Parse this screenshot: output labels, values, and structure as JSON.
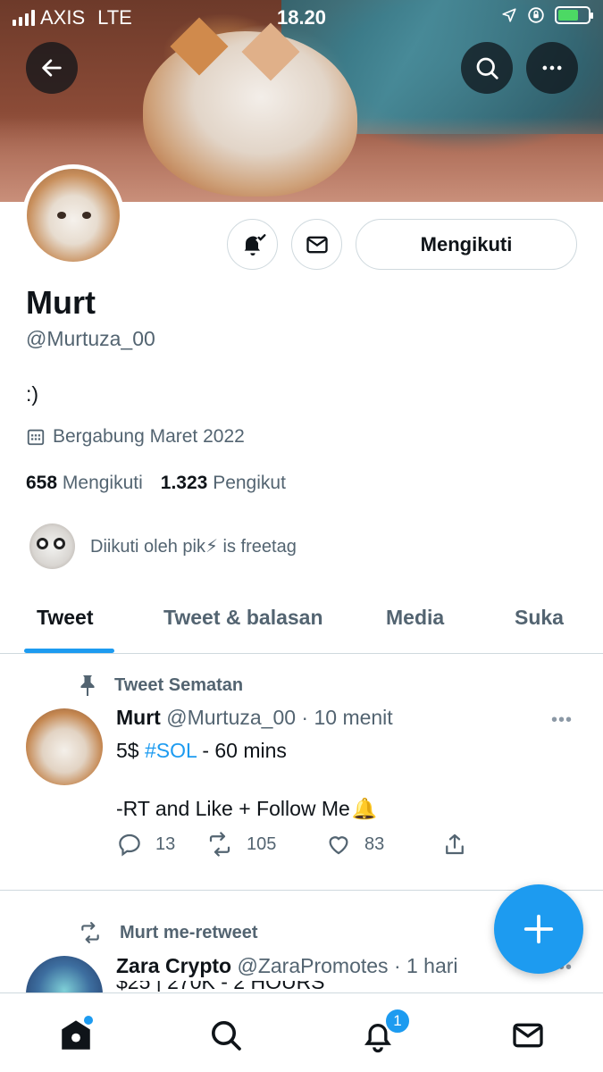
{
  "status_bar": {
    "carrier": "AXIS",
    "network": "LTE",
    "time": "18.20"
  },
  "header": {
    "back_icon": "arrow-left-icon",
    "search_icon": "search-icon",
    "more_icon": "more-horizontal-icon"
  },
  "profile": {
    "name": "Murt",
    "handle": "@Murtuza_00",
    "bio": ":)",
    "joined": "Bergabung Maret 2022",
    "following_count": "658",
    "following_label": "Mengikuti",
    "followers_count": "1.323",
    "followers_label": "Pengikut",
    "followed_by": "Diikuti oleh pik⚡ is freetag",
    "follow_button": "Mengikuti"
  },
  "tabs": [
    {
      "label": "Tweet",
      "active": true
    },
    {
      "label": "Tweet & balasan",
      "active": false
    },
    {
      "label": "Media",
      "active": false
    },
    {
      "label": "Suka",
      "active": false
    }
  ],
  "tweets": [
    {
      "context": "Tweet Sematan",
      "author": "Murt",
      "handle": "@Murtuza_00",
      "time": "· 10 menit",
      "text_prefix": "5$ ",
      "hashtag": "#SOL",
      "text_suffix": " - 60 mins",
      "text_line2": "-RT and Like + Follow Me",
      "emoji": "🔔",
      "replies": "13",
      "retweets": "105",
      "likes": "83",
      "more": "•••"
    },
    {
      "context": "Murt me-retweet",
      "author": "Zara Crypto",
      "handle": "@ZaraPromotes",
      "time": "· 1 hari",
      "text_preview": "$25 | 270K - 2 HOURS",
      "more": "•••"
    }
  ],
  "bottom_nav": {
    "notifications_badge": "1"
  },
  "colors": {
    "accent": "#1d9bf0",
    "text": "#0f1419",
    "secondary": "#536471",
    "border": "#cfd9de"
  }
}
